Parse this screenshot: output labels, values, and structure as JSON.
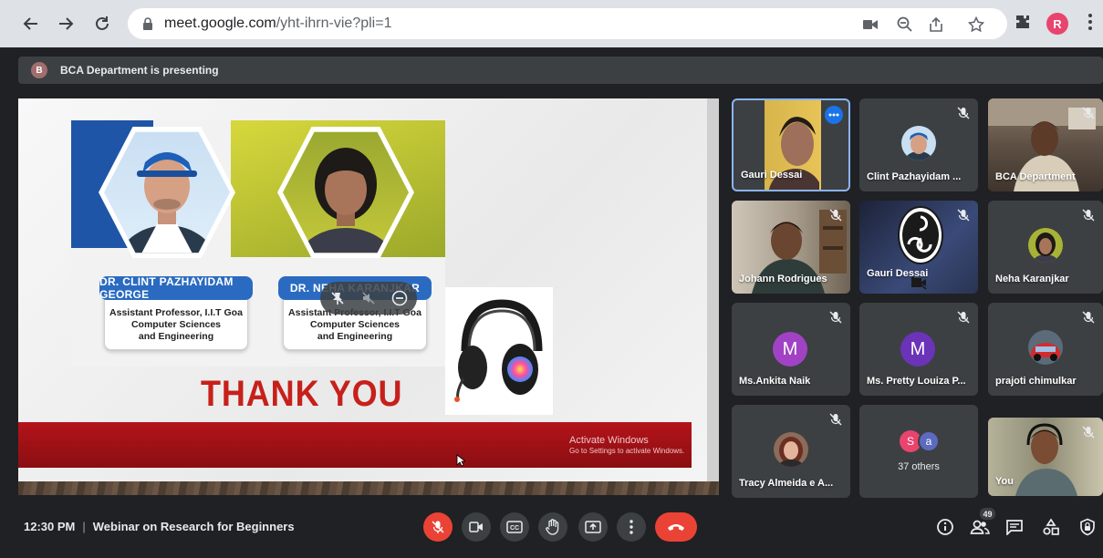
{
  "browser": {
    "url_host": "meet.google.com",
    "url_path": "/yht-ihrn-vie?pli=1",
    "profile_initial": "R",
    "profile_color": "#e8446e"
  },
  "banner": {
    "avatar_initial": "B",
    "text": "BCA Department is presenting"
  },
  "slide": {
    "person1_name": "DR. CLINT PAZHAYIDAM GEORGE",
    "person1_desc": [
      "Assistant Professor, I.I.T Goa",
      "Computer Sciences",
      "and Engineering"
    ],
    "person2_name": "DR. NEHA KARANJKAR",
    "person2_desc": [
      "Assistant Professor, I.I.T Goa",
      "Computer Sciences",
      "and Engineering"
    ],
    "thank_you": "THANK YOU",
    "watermark_title": "Activate Windows",
    "watermark_sub": "Go to Settings to activate Windows."
  },
  "participants": [
    {
      "name": "Gauri Dessai",
      "type": "video",
      "active": true
    },
    {
      "name": "Clint Pazhayidam ...",
      "type": "photo",
      "muted": true
    },
    {
      "name": "BCA Department",
      "type": "video",
      "muted": true
    },
    {
      "name": "Johann Rodrigues",
      "type": "video",
      "muted": true
    },
    {
      "name": "Gauri Dessai",
      "type": "obs",
      "muted": true
    },
    {
      "name": "Neha Karanjkar",
      "type": "photo",
      "muted": true
    },
    {
      "name": "Ms.Ankita Naik",
      "type": "letter",
      "initial": "M",
      "color": "#a142c4",
      "muted": true
    },
    {
      "name": "Ms. Pretty Louiza P...",
      "type": "letter",
      "initial": "M",
      "color": "#6a33b8",
      "muted": true
    },
    {
      "name": "prajoti chimulkar",
      "type": "photo",
      "muted": true
    },
    {
      "name": "Tracy Almeida e A...",
      "type": "photo",
      "muted": true
    },
    {
      "name": "37 others",
      "type": "others",
      "initials": [
        "S",
        "a"
      ]
    },
    {
      "name": "You",
      "type": "video",
      "muted": true
    }
  ],
  "bottom": {
    "time": "12:30 PM",
    "meeting_title": "Webinar on Research for Beginners",
    "people_count": "49"
  },
  "colors": {
    "accent_blue": "#8ab4f8",
    "end_call_red": "#ea4335",
    "tile_bg": "#3c4043",
    "page_bg": "#202124"
  }
}
